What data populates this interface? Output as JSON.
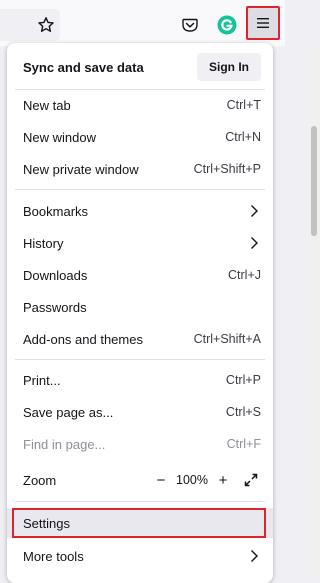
{
  "toolbar": {
    "icons": [
      "star-icon",
      "pocket-icon",
      "grammarly-icon",
      "hamburger-menu-icon"
    ],
    "highlight_color": "#e0222e",
    "grammarly_color": "#15c39a"
  },
  "menu": {
    "sync_label": "Sync and save data",
    "sign_in_label": "Sign In",
    "new_tab": {
      "label": "New tab",
      "shortcut": "Ctrl+T"
    },
    "new_window": {
      "label": "New window",
      "shortcut": "Ctrl+N"
    },
    "new_private_window": {
      "label": "New private window",
      "shortcut": "Ctrl+Shift+P"
    },
    "bookmarks": {
      "label": "Bookmarks"
    },
    "history": {
      "label": "History"
    },
    "downloads": {
      "label": "Downloads",
      "shortcut": "Ctrl+J"
    },
    "passwords": {
      "label": "Passwords"
    },
    "addons": {
      "label": "Add-ons and themes",
      "shortcut": "Ctrl+Shift+A"
    },
    "print": {
      "label": "Print...",
      "shortcut": "Ctrl+P"
    },
    "save_page": {
      "label": "Save page as...",
      "shortcut": "Ctrl+S"
    },
    "find": {
      "label": "Find in page...",
      "shortcut": "Ctrl+F"
    },
    "zoom": {
      "label": "Zoom",
      "minus": "−",
      "value": "100%",
      "plus": "+"
    },
    "settings": {
      "label": "Settings"
    },
    "more_tools": {
      "label": "More tools"
    }
  }
}
